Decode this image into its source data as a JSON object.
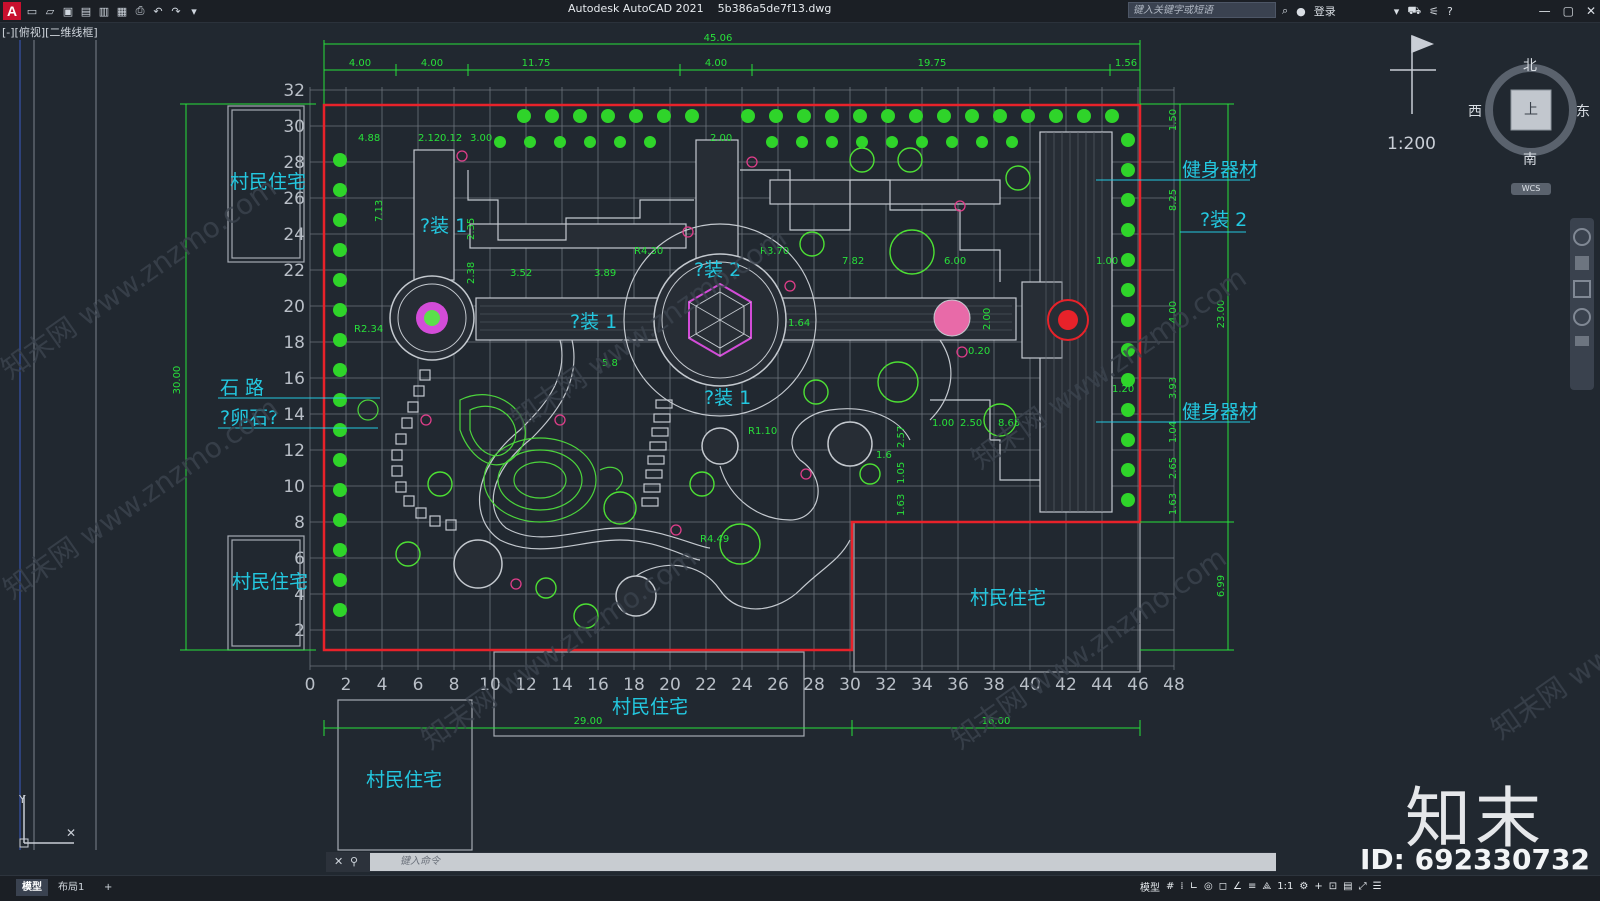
{
  "titlebar": {
    "app_title": "Autodesk AutoCAD 2021",
    "file_name": "5b386a5de7f13.dwg",
    "search_placeholder": "键入关键字或短语",
    "login_label": "登录"
  },
  "viewport_label": "[-][俯视][二维线框]",
  "viewcube": {
    "north": "北",
    "south": "南",
    "east": "东",
    "west": "西",
    "top": "上",
    "wcs": "WCS"
  },
  "scale_label": "1:200",
  "drawing": {
    "labels": {
      "village_house": "村民住宅",
      "fitness_equipment": "健身器材",
      "stone_path": "石 路",
      "pebble": "?卵石?",
      "install_1": "?装 1",
      "install_2": "?装 2"
    },
    "top_dims": [
      "4.00",
      "4.00",
      "11.75",
      "4.00",
      "19.75",
      "1.56"
    ],
    "overall_width": "45.06",
    "bottom_dims": [
      "29.00",
      "16.00"
    ],
    "left_dim": "30.00",
    "right_dims": [
      "1.50",
      "8.25",
      "4.00",
      "23.00",
      "3.93",
      "1.04",
      "2.65",
      "1.63",
      "6.99"
    ],
    "x_ticks": [
      "0",
      "2",
      "4",
      "6",
      "8",
      "10",
      "12",
      "14",
      "16",
      "18",
      "20",
      "22",
      "24",
      "26",
      "28",
      "30",
      "32",
      "34",
      "36",
      "38",
      "40",
      "42",
      "44",
      "46",
      "48"
    ],
    "y_ticks": [
      "32",
      "30",
      "28",
      "26",
      "24",
      "22",
      "20",
      "18",
      "16",
      "14",
      "12",
      "10",
      "8",
      "6",
      "4",
      "2"
    ],
    "inner_dims": [
      "4.88",
      "2.12",
      "0.12",
      "3.00",
      "2.00",
      "7.13",
      "2.35",
      "2.38",
      "3.52",
      "3.89",
      "R4.30",
      "R3.70",
      "7.82",
      "6.00",
      "1.00",
      "R2.34",
      "5.8",
      "1.64",
      "2.00",
      "0.20",
      "1.20",
      "R1.10",
      "2.57",
      "1.05",
      "1.63",
      "R4.49",
      "1.6",
      "1.00",
      "2.50",
      "8.65"
    ]
  },
  "command": {
    "placeholder": "键入命令"
  },
  "status": {
    "tab_model": "模型",
    "tab_layout": "布局1",
    "add_tab": "+",
    "model_label": "模型",
    "scale": "1:1"
  },
  "watermark": {
    "brand": "知末",
    "id": "ID: 692330732",
    "site": "知末网 www.znzmo.com"
  }
}
